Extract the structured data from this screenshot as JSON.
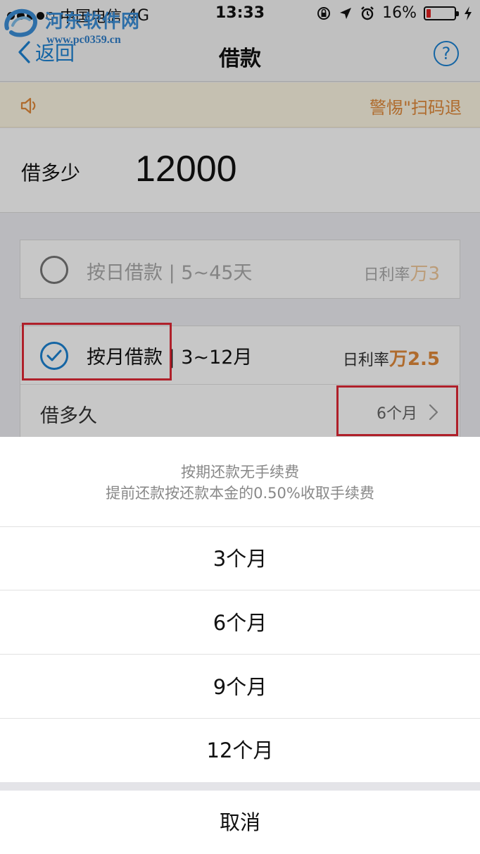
{
  "status_bar": {
    "carrier": "中国电信",
    "network": "4G",
    "time": "13:33",
    "battery": "16%",
    "battery_level": 0.16,
    "battery_color": "#e02020"
  },
  "watermark": {
    "title": "河东软件网",
    "url": "www.pc0359.cn"
  },
  "nav": {
    "back_label": "返回",
    "title": "借款",
    "help_label": "?"
  },
  "notice": {
    "text": "警惕\"扫码退"
  },
  "amount": {
    "label": "借多少",
    "value": "12000"
  },
  "options": {
    "daily": {
      "label": "按日借款 | 5~45天",
      "rate_label": "日利率",
      "rate_value": "万3",
      "selected": false
    },
    "monthly": {
      "label_main": "按月借款",
      "label_range": "| 3~12月",
      "rate_label": "日利率",
      "rate_value": "万2.5",
      "selected": true,
      "duration_label": "借多久",
      "duration_value": "6个月"
    }
  },
  "sheet": {
    "line1": "按期还款无手续费",
    "line2": "提前还款按还款本金的0.50%收取手续费",
    "options": [
      "3个月",
      "6个月",
      "9个月",
      "12个月"
    ],
    "cancel": "取消"
  },
  "colors": {
    "accent": "#1b82d2",
    "rate": "#e0893a",
    "highlight": "#e02a36"
  },
  "icons": {
    "back": "chevron-left-icon",
    "help": "question-circle-icon",
    "speaker": "speaker-icon",
    "check": "check-icon",
    "chevron_right": "chevron-right-icon"
  }
}
